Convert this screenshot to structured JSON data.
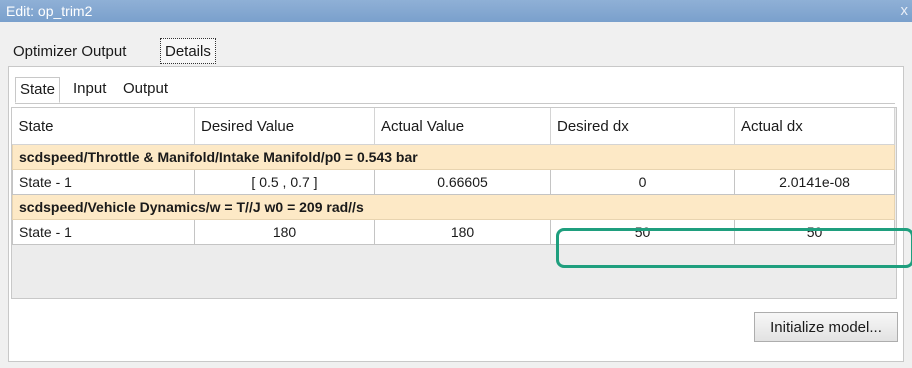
{
  "window": {
    "title": "Edit: op_trim2",
    "close_glyph": "x"
  },
  "outer_tabs": [
    {
      "label": "Optimizer Output"
    },
    {
      "label": "Details"
    }
  ],
  "inner_tabs": [
    {
      "label": "State"
    },
    {
      "label": "Input"
    },
    {
      "label": "Output"
    }
  ],
  "table": {
    "headers": [
      "State",
      "Desired Value",
      "Actual Value",
      "Desired dx",
      "Actual dx"
    ],
    "groups": [
      {
        "title": "scdspeed/Throttle & Manifold/Intake Manifold/p0 = 0.543 bar",
        "row": [
          "State - 1",
          "[ 0.5 , 0.7 ]",
          "0.66605",
          "0",
          "2.0141e-08"
        ]
      },
      {
        "title": "scdspeed/Vehicle Dynamics/w = T//J w0 = 209 rad//s",
        "row": [
          "State - 1",
          "180",
          "180",
          "50",
          "50"
        ]
      }
    ]
  },
  "initialize_button": {
    "label": "Initialize model..."
  },
  "colors": {
    "highlight": "#1f9f7e",
    "group_row": "#fde9c6",
    "title_bar": "#7aa0cc"
  }
}
